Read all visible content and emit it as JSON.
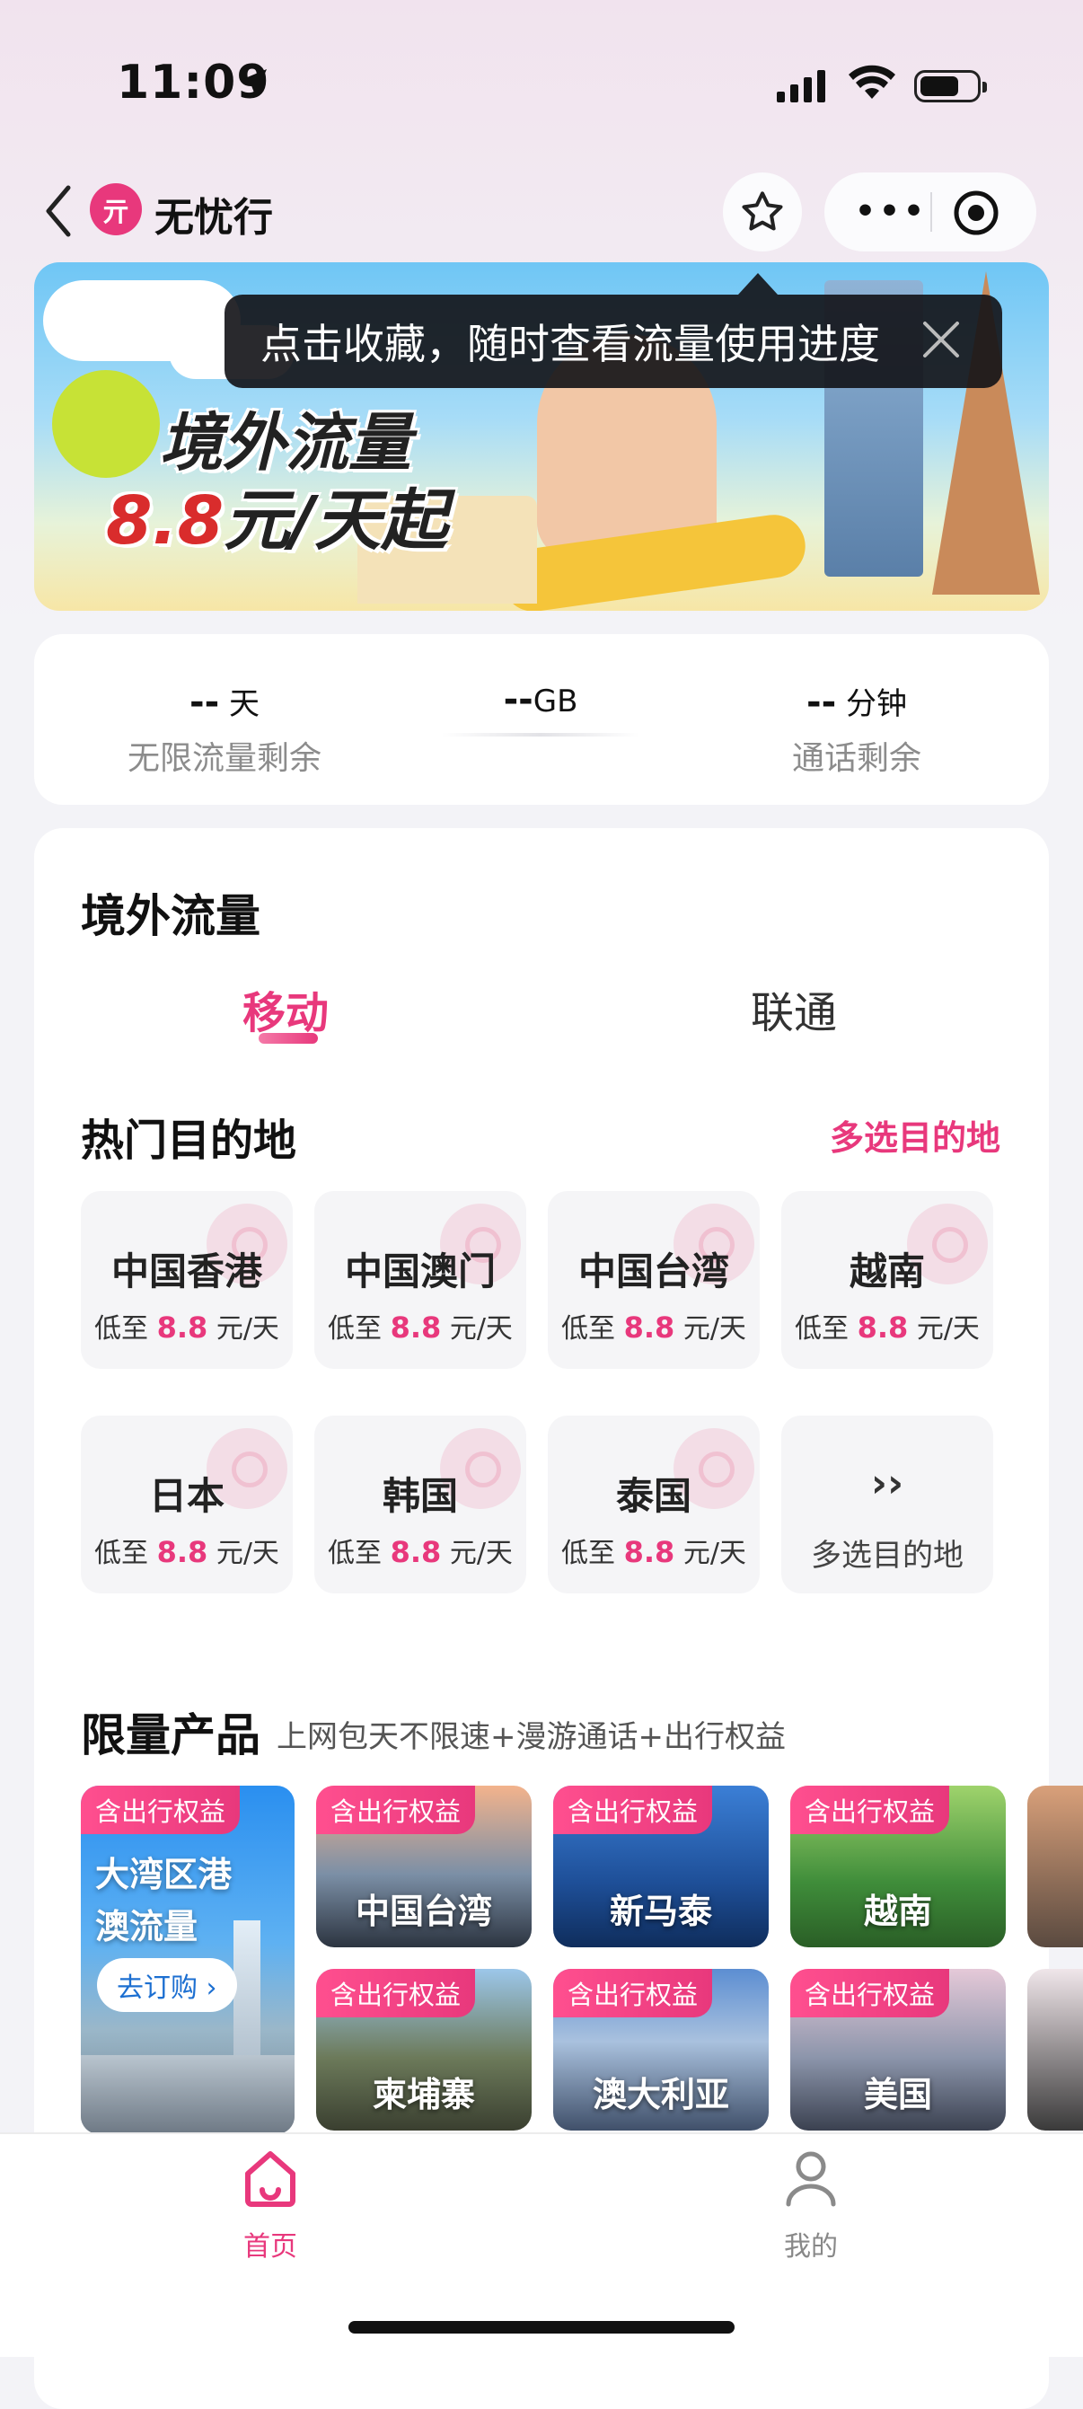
{
  "status_bar": {
    "time": "11:09"
  },
  "nav": {
    "logo_text": "亓",
    "title": "无忧行"
  },
  "banner": {
    "line1": "境外流量",
    "line2_price": "8.8",
    "line2_rest": "元/天起"
  },
  "tooltip": {
    "text": "点击收藏，随时查看流量使用进度"
  },
  "stats": [
    {
      "value": "--",
      "unit": "天",
      "label": "无限流量剩余"
    },
    {
      "value": "--",
      "unit": "GB",
      "label": ""
    },
    {
      "value": "--",
      "unit": "分钟",
      "label": "通话剩余"
    }
  ],
  "section": {
    "title": "境外流量",
    "tabs": [
      "移动",
      "联通"
    ],
    "hot_title": "热门目的地",
    "hot_more": "多选目的地"
  },
  "destinations": [
    {
      "name": "中国香港",
      "prefix": "低至",
      "price": "8.8",
      "unit": "元/天"
    },
    {
      "name": "中国澳门",
      "prefix": "低至",
      "price": "8.8",
      "unit": "元/天"
    },
    {
      "name": "中国台湾",
      "prefix": "低至",
      "price": "8.8",
      "unit": "元/天"
    },
    {
      "name": "越南",
      "prefix": "低至",
      "price": "8.8",
      "unit": "元/天"
    },
    {
      "name": "日本",
      "prefix": "低至",
      "price": "8.8",
      "unit": "元/天"
    },
    {
      "name": "韩国",
      "prefix": "低至",
      "price": "8.8",
      "unit": "元/天"
    },
    {
      "name": "泰国",
      "prefix": "低至",
      "price": "8.8",
      "unit": "元/天"
    }
  ],
  "more_tile": {
    "arrow": "››",
    "label": "多选目的地"
  },
  "limited": {
    "title": "限量产品",
    "subtitle": "上网包天不限速+漫游通话+出行权益",
    "tag": "含出行权益",
    "big": {
      "name": "大湾区港澳流量",
      "button": "去订购 ›"
    },
    "products": [
      "中国台湾",
      "新马泰",
      "越南",
      "柬埔寨",
      "澳大利亚",
      "美国"
    ]
  },
  "tabbar": {
    "home": "首页",
    "me": "我的"
  },
  "colors": {
    "accent": "#e8387c",
    "price": "#e8387c"
  }
}
